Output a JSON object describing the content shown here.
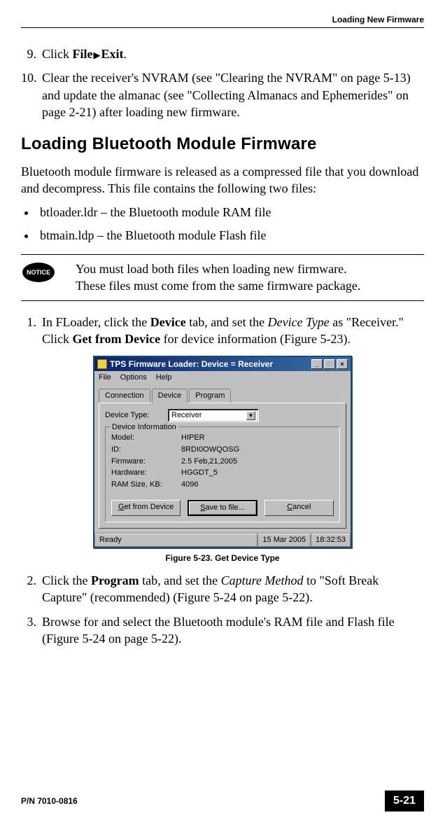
{
  "header": {
    "right": "Loading New Firmware"
  },
  "steps_a": [
    {
      "num": "9.",
      "pre": "Click ",
      "bold1": "File",
      "arrow": "▶",
      "bold2": "Exit",
      "post": "."
    },
    {
      "num": "10.",
      "text": "Clear the receiver's NVRAM (see \"Clearing the NVRAM\" on page 5-13) and update the almanac (see \"Collecting Almanacs and Ephemerides\" on page 2-21) after loading new firmware."
    }
  ],
  "section_title": "Loading Bluetooth Module Firmware",
  "intro": "Bluetooth module firmware is released as a compressed file that you download and decompress. This file contains the following two files:",
  "bullets": [
    "btloader.ldr – the Bluetooth module RAM file",
    "btmain.ldp – the Bluetooth module Flash file"
  ],
  "notice": {
    "badge": "NOTICE",
    "text": "You must load both files when loading new firmware. These files must come from the same firmware package."
  },
  "steps_b": [
    {
      "num": "1.",
      "parts": [
        "In FLoader, click the ",
        {
          "b": "Device"
        },
        " tab, and set the ",
        {
          "i": "Device Type"
        },
        " as \"Receiver.\" Click ",
        {
          "b": "Get from Device"
        },
        " for device information (Figure 5-23)."
      ]
    },
    {
      "num": "2.",
      "parts": [
        "Click the ",
        {
          "b": "Program"
        },
        " tab, and set the ",
        {
          "i": "Capture Method"
        },
        " to \"Soft Break Capture\" (recommended) (Figure 5-24 on page 5-22)."
      ]
    },
    {
      "num": "3.",
      "parts": [
        "Browse for and select the Bluetooth module's RAM file and Flash file (Figure 5-24 on page 5-22)."
      ]
    }
  ],
  "figure": {
    "title": "TPS Firmware Loader:   Device = Receiver",
    "menu": [
      "File",
      "Options",
      "Help"
    ],
    "tabs": [
      "Connection",
      "Device",
      "Program"
    ],
    "device_type_label": "Device Type:",
    "device_type_value": "Receiver",
    "group_title": "Device Information",
    "info": [
      {
        "label": "Model:",
        "value": "HIPER"
      },
      {
        "label": "ID:",
        "value": "8RDI0OWQOSG"
      },
      {
        "label": "Firmware:",
        "value": "2.5 Feb,21,2005"
      },
      {
        "label": "Hardware:",
        "value": "HGGDT_5"
      },
      {
        "label": "RAM Size, KB:",
        "value": "4096"
      }
    ],
    "buttons": {
      "get": "Get from Device",
      "save": "Save to file...",
      "cancel": "Cancel"
    },
    "status": {
      "left": "Ready",
      "date": "15 Mar 2005",
      "time": "18:32:53"
    },
    "caption": "Figure 5-23. Get Device Type"
  },
  "footer": {
    "pn": "P/N 7010-0816",
    "page": "5-21"
  }
}
